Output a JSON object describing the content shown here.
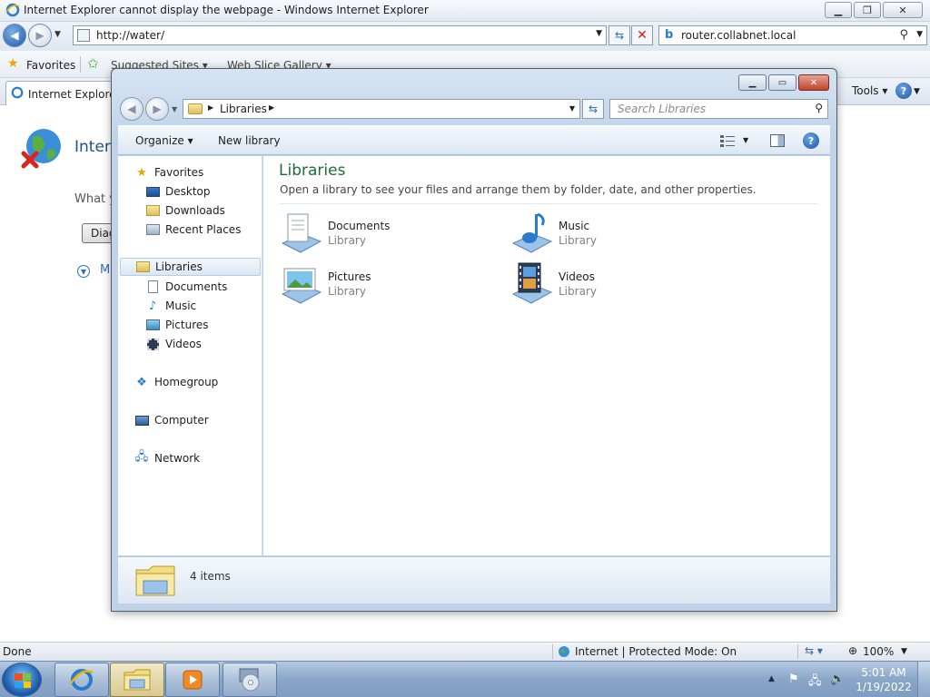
{
  "ie": {
    "title": "Internet Explorer cannot display the webpage - Windows Internet Explorer",
    "address_url": "http://water/",
    "search_value": "router.collabnet.local",
    "favorites_label": "Favorites",
    "fav_items": [
      "Suggested Sites ▾",
      "Web Slice Gallery ▾"
    ],
    "tab_label": "Internet Explorer c",
    "tools_label": "Tools ▾",
    "content": {
      "heading": "Intern",
      "what_text": "What y",
      "diag_label": "Diag",
      "more_label": "M"
    },
    "status": {
      "left": "Done",
      "zone": "Internet | Protected Mode: On",
      "zoom": "100%"
    }
  },
  "explorer": {
    "breadcrumb": "Libraries",
    "search_placeholder": "Search Libraries",
    "toolbar": {
      "organize": "Organize ▾",
      "new_library": "New library"
    },
    "nav": {
      "favorites": "Favorites",
      "favorites_items": [
        "Desktop",
        "Downloads",
        "Recent Places"
      ],
      "libraries": "Libraries",
      "libraries_items": [
        "Documents",
        "Music",
        "Pictures",
        "Videos"
      ],
      "homegroup": "Homegroup",
      "computer": "Computer",
      "network": "Network"
    },
    "main": {
      "title": "Libraries",
      "subtitle": "Open a library to see your files and arrange them by folder, date, and other properties.",
      "libraries": [
        {
          "name": "Documents",
          "kind": "Library"
        },
        {
          "name": "Music",
          "kind": "Library"
        },
        {
          "name": "Pictures",
          "kind": "Library"
        },
        {
          "name": "Videos",
          "kind": "Library"
        }
      ]
    },
    "details": {
      "count": "4 items"
    }
  },
  "taskbar": {
    "time": "5:01 AM",
    "date": "1/19/2022"
  },
  "colors": {
    "library_title": "#1e6b3a",
    "link_blue": "#2d6fb8",
    "close_red": "#c0442b"
  }
}
